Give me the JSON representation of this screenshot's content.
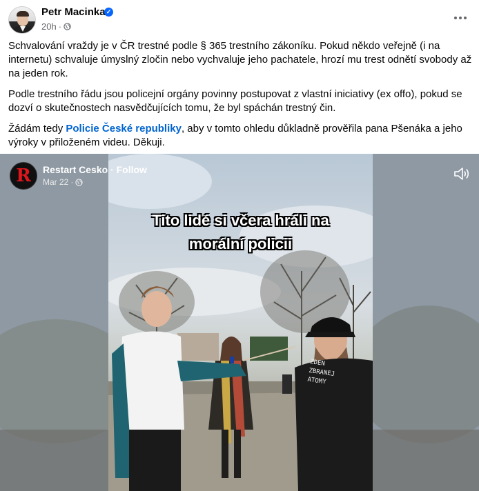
{
  "post": {
    "author": "Petr Macinka",
    "time": "20h",
    "separator": "·",
    "paragraph1": "Schvalování vraždy je v ČR trestné podle § 365 trestního zákoníku. Pokud někdo veřejně (i na internetu) schvaluje úmyslný zločin nebo vychvaluje jeho pachatele, hrozí mu trest odnětí svobody až na jeden rok.",
    "paragraph2": "Podle trestního řádu jsou policejní orgány povinny postupovat z vlastní iniciativy (ex offo), pokud se dozví o skutečnostech nasvědčujících tomu, že byl spáchán trestný čin.",
    "paragraph3_before": "Žádám tedy ",
    "mention": "Policie České republiky",
    "paragraph3_after": ", aby v tomto ohledu důkladně prověřila pana Pšenáka a jeho výroky v přiloženém videu. Děkuji."
  },
  "shared_video": {
    "page_name": "Restart Cesko",
    "separator": " · ",
    "follow_label": "Follow",
    "date": "Mar 22",
    "date_separator": "·",
    "logo_letter": "R",
    "caption_line1": "Tito lidé si včera hráli na",
    "caption_line2": "morální policii",
    "shirt_text_line1": "ZDEN",
    "shirt_text_line2": "ZBRANEJ",
    "shirt_text_line3": "ATOMY"
  },
  "icons": {
    "verified": "verified-badge-icon",
    "audience": "globe-icon",
    "more": "more-options-icon",
    "sound": "speaker-icon"
  },
  "colors": {
    "accent": "#0866ff",
    "mention": "#0064d1",
    "secondary_text": "#65676b",
    "logo_red": "#e0161c"
  }
}
